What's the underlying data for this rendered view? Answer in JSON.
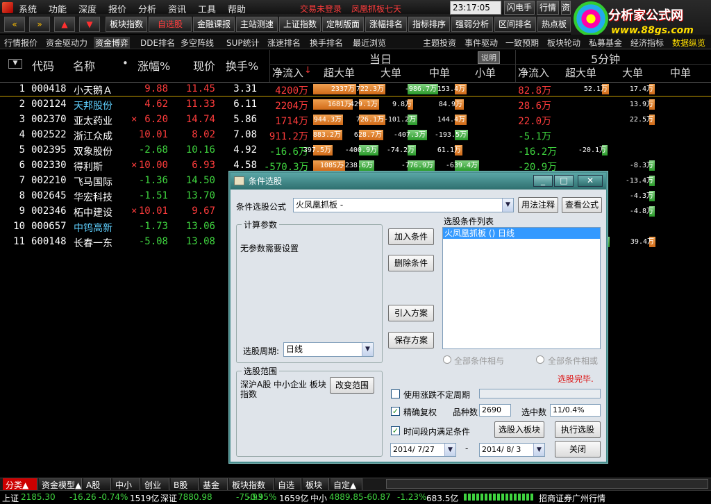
{
  "menu": {
    "items": [
      "系统",
      "功能",
      "深度",
      "报价",
      "分析",
      "资讯",
      "工具",
      "帮助"
    ],
    "login_status": "交易未登录",
    "formula_title": "凤凰抓板七天",
    "clock": "23:17:05 周日",
    "buttons": [
      "闪电手",
      "行情",
      "资"
    ]
  },
  "brand": {
    "name": "分析家公式网",
    "url": "www.88gs.com"
  },
  "toolbar": {
    "nav_left": "«",
    "nav_right": "»",
    "up": "▲",
    "down": "▼",
    "buttons": [
      "板块指数",
      "自选股",
      "金融课报",
      "主站测速",
      "上证指数",
      "定制版面",
      "涨幅排名",
      "指标排序",
      "强弱分析",
      "区间排名",
      "热点板"
    ]
  },
  "tabs2": {
    "left": [
      "行情报价",
      "资金驱动力",
      "资金博弈",
      "DDE排名",
      "多空阵线",
      "SUP统计",
      "涨速排名",
      "换手排名",
      "最近浏览"
    ],
    "right": [
      "主题投资",
      "事件驱动",
      "一致预期",
      "板块轮动",
      "私募基金",
      "经济指标",
      "数据纵览"
    ],
    "active": "资金博弈"
  },
  "header": {
    "menu_icon": "▼",
    "code": "代码",
    "name": "名称",
    "dot": "•",
    "change": "涨幅%",
    "price": "现价",
    "turnover": "换手%",
    "today": "当日",
    "explain": "说明",
    "fivemin": "5分钟",
    "sort_arrow": "↓",
    "cols_today": [
      "净流入",
      "超大单",
      "大单",
      "中单",
      "小单"
    ],
    "cols_5min": [
      "净流入",
      "超大单",
      "大单",
      "中单"
    ]
  },
  "rows": [
    {
      "n": "1",
      "code": "000418",
      "name": "小天鹅Ａ",
      "mark": "",
      "chg": "9.88",
      "price": "11.45",
      "turn": "3.31",
      "net": "4200万",
      "xl": "2337万",
      "l": "722.3万",
      "m": "-986.7万",
      "s": "153.4万",
      "net5": "82.8万",
      "xl5": "",
      "l5": "52.1万",
      "m5": "17.4万"
    },
    {
      "n": "2",
      "code": "002124",
      "name": "天邦股份",
      "mark": "",
      "chg": "4.62",
      "price": "11.33",
      "turn": "6.11",
      "net": "2204万",
      "xl": "1681万",
      "l": "429.1万",
      "m": "9.8万",
      "s": "84.9万",
      "net5": "28.6万",
      "xl5": "",
      "l5": "",
      "m5": "13.9万"
    },
    {
      "n": "3",
      "code": "002370",
      "name": "亚太药业",
      "mark": "×",
      "chg": "6.20",
      "price": "14.74",
      "turn": "5.86",
      "net": "1714万",
      "xl": "944.3万",
      "l": "726.1万",
      "m": "-101.2万",
      "s": "144.4万",
      "net5": "22.0万",
      "xl5": "",
      "l5": "",
      "m5": "22.5万"
    },
    {
      "n": "4",
      "code": "002522",
      "name": "浙江众成",
      "mark": "",
      "chg": "10.01",
      "price": "8.02",
      "turn": "7.08",
      "net": "911.2万",
      "xl": "883.2万",
      "l": "628.7万",
      "m": "-407.3万",
      "s": "-193.5万",
      "net5": "-5.1万",
      "xl5": "",
      "l5": "",
      "m5": ""
    },
    {
      "n": "5",
      "code": "002395",
      "name": "双象股份",
      "mark": "",
      "chg": "-2.68",
      "price": "10.16",
      "turn": "4.92",
      "net": "-16.6万",
      "xl": "397.5万",
      "l": "-400.9万",
      "m": "-74.2万",
      "s": "61.1万",
      "net5": "-16.2万",
      "xl5": "",
      "l5": "-20.1万",
      "m5": ""
    },
    {
      "n": "6",
      "code": "002330",
      "name": "得利斯",
      "mark": "×",
      "chg": "10.00",
      "price": "6.93",
      "turn": "4.58",
      "net": "-570.3万",
      "xl": "1085万",
      "l": "-238.6万",
      "m": "-776.9万",
      "s": "-639.4万",
      "net5": "-20.9万",
      "xl5": "",
      "l5": "",
      "m5": "-8.3万"
    },
    {
      "n": "7",
      "code": "002210",
      "name": "飞马国际",
      "mark": "",
      "chg": "-1.36",
      "price": "14.50",
      "turn": "",
      "net": "",
      "xl": "",
      "l": "",
      "m": "",
      "s": "",
      "net5": "",
      "xl5": "",
      "l5": "",
      "m5": "-13.4万"
    },
    {
      "n": "8",
      "code": "002645",
      "name": "华宏科技",
      "mark": "",
      "chg": "-1.51",
      "price": "13.70",
      "turn": "",
      "net": "",
      "xl": "",
      "l": "",
      "m": "",
      "s": "",
      "net5": "",
      "xl5": "",
      "l5": "",
      "m5": "-4.3万"
    },
    {
      "n": "9",
      "code": "002346",
      "name": "柘中建设",
      "mark": "×",
      "chg": "10.01",
      "price": "9.67",
      "turn": "",
      "net": "",
      "xl": "",
      "l": "",
      "m": "",
      "s": "",
      "net5": "",
      "xl5": "",
      "l5": "",
      "m5": "-4.8万"
    },
    {
      "n": "10",
      "code": "000657",
      "name": "中钨高新",
      "mark": "",
      "chg": "-1.73",
      "price": "13.06",
      "turn": "",
      "net": "",
      "xl": "",
      "l": "",
      "m": "",
      "s": "",
      "net5": "",
      "xl5": "",
      "l5": "-23.0万",
      "m5": ""
    },
    {
      "n": "11",
      "code": "600148",
      "name": "长春一东",
      "mark": "",
      "chg": "-5.08",
      "price": "13.08",
      "turn": "",
      "net": "",
      "xl": "",
      "l": "",
      "m": "",
      "s": "",
      "net5": "",
      "xl5": "",
      "l5": "-64.8万",
      "m5": "39.4万"
    }
  ],
  "dialog": {
    "title": "条件选股",
    "formula_label": "条件选股公式",
    "formula_value": "火凤凰抓板 -",
    "usage_btn": "用法注释",
    "view_btn": "查看公式",
    "params_title": "计算参数",
    "params_text": "无参数需要设置",
    "period_label": "选股周期:",
    "period_value": "日线",
    "add_btn": "加入条件",
    "delete_btn": "删除条件",
    "import_btn": "引入方案",
    "save_btn": "保存方案",
    "list_title": "选股条件列表",
    "list_items": [
      "火凤凰抓板  () 日线"
    ],
    "radio_and": "全部条件相与",
    "radio_or": "全部条件相或",
    "done_text": "选股完毕.",
    "range_title": "选股范围",
    "range_text": "深沪A股 中小企业 板块指数",
    "change_range_btn": "改变范围",
    "cb_unfixed": "使用涨跌不定周期",
    "cb_adjust": "精确复权",
    "variety_label": "品种数",
    "variety_value": "2690",
    "selected_label": "选中数",
    "selected_value": "11/0.4%",
    "cb_period": "时间段内满足条件",
    "to_block_btn": "选股入板块",
    "run_btn": "执行选股",
    "date_from": "2014/ 7/27",
    "dash": "-",
    "date_to": "2014/ 8/ 3",
    "close_btn": "关闭",
    "check_mark": "✓"
  },
  "bottom_tabs": [
    "分类▲",
    "资金模型▲",
    "A股",
    "中小",
    "创业",
    "B股",
    "基金",
    "板块指数",
    "自选",
    "板块",
    "自定▲"
  ],
  "status": {
    "sh_label": "上证",
    "sh_val": "2185.30",
    "sh_chg": "-16.26",
    "sh_pct": "-0.74%",
    "sh_amt": "1519亿",
    "sz_label": "深证",
    "sz_val": "7880.98",
    "sz_chg": "-75.93",
    "sz_pct": "-0.95%",
    "sz_amt": "1659亿",
    "zx_label": "中小",
    "zx_val": "4889.85",
    "zx_chg": "-60.87",
    "zx_pct": "-1.23%",
    "zx_amt": "683.5亿",
    "broker": "招商证券广州行情"
  }
}
